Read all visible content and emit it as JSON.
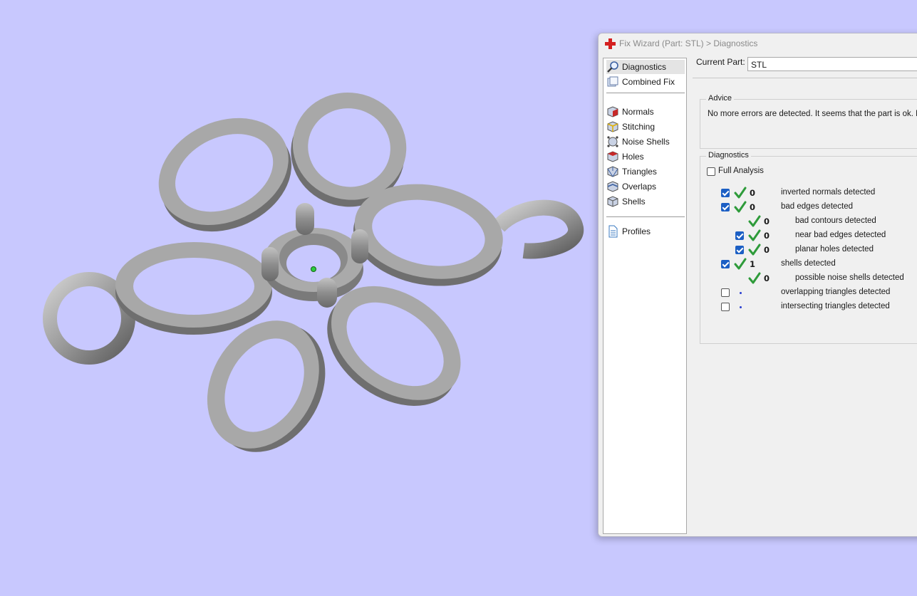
{
  "window": {
    "title": "Fix Wizard (Part: STL) > Diagnostics",
    "title_icon": "red-cross-icon"
  },
  "nav": {
    "items": [
      {
        "label": "Diagnostics",
        "icon": "magnifier-icon",
        "selected": true
      },
      {
        "label": "Combined Fix",
        "icon": "combined-fix-icon"
      },
      {
        "label": "Normals",
        "icon": "normals-cube-icon"
      },
      {
        "label": "Stitching",
        "icon": "stitching-cube-icon"
      },
      {
        "label": "Noise Shells",
        "icon": "noise-shells-icon"
      },
      {
        "label": "Holes",
        "icon": "holes-cube-icon"
      },
      {
        "label": "Triangles",
        "icon": "triangles-cube-icon"
      },
      {
        "label": "Overlaps",
        "icon": "overlaps-cube-icon"
      },
      {
        "label": "Shells",
        "icon": "shells-cube-icon"
      },
      {
        "label": "Profiles",
        "icon": "document-icon"
      }
    ]
  },
  "current_part": {
    "label": "Current Part:",
    "value": "STL"
  },
  "advice": {
    "title": "Advice",
    "text": "No more errors are detected. It seems that the part is ok. No"
  },
  "diagnostics": {
    "title": "Diagnostics",
    "full_analysis": {
      "label": "Full Analysis",
      "checked": false
    },
    "rows": [
      {
        "checkbox": true,
        "checked": true,
        "status": "ok",
        "count": "0",
        "label": "inverted normals detected",
        "indent": 0
      },
      {
        "checkbox": true,
        "checked": true,
        "status": "ok",
        "count": "0",
        "label": "bad edges detected",
        "indent": 0
      },
      {
        "checkbox": false,
        "checked": false,
        "status": "ok",
        "count": "0",
        "label": "bad contours detected",
        "indent": 1
      },
      {
        "checkbox": true,
        "checked": true,
        "status": "ok",
        "count": "0",
        "label": "near bad edges detected",
        "indent": 1
      },
      {
        "checkbox": true,
        "checked": true,
        "status": "ok",
        "count": "0",
        "label": "planar holes detected",
        "indent": 1
      },
      {
        "checkbox": true,
        "checked": true,
        "status": "ok",
        "count": "1",
        "label": "shells detected",
        "indent": 0
      },
      {
        "checkbox": false,
        "checked": false,
        "status": "ok",
        "count": "0",
        "label": "possible noise shells detected",
        "indent": 1
      },
      {
        "checkbox": true,
        "checked": false,
        "status": "pending",
        "count": "",
        "label": "overlapping triangles detected",
        "indent": 0
      },
      {
        "checkbox": true,
        "checked": false,
        "status": "pending",
        "count": "",
        "label": "intersecting triangles detected",
        "indent": 0
      }
    ]
  },
  "colors": {
    "viewport_bg": "#c8c8fe",
    "model_gray": "#9a9a9a",
    "check_green": "#2e9b3a",
    "checkbox_blue": "#1c5fc4",
    "title_icon_red": "#d42020"
  }
}
